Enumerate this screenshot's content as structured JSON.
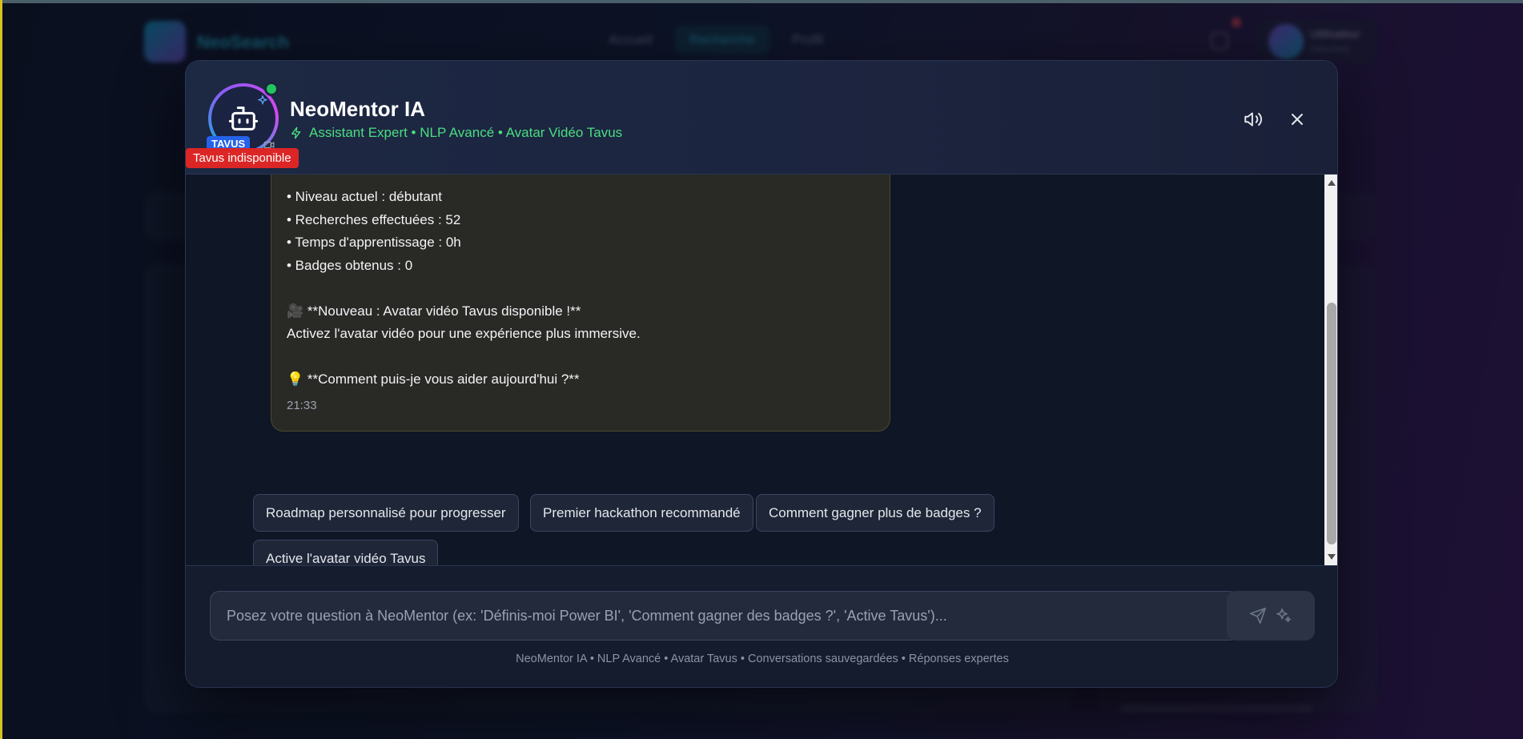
{
  "background": {
    "brand": "NeoSearch",
    "nav": [
      "Accueil",
      "Recherche",
      "Profil"
    ],
    "user_name": "Utilisateur",
    "user_role": "Débutant"
  },
  "modal": {
    "title": "NeoMentor IA",
    "subtitle": "Assistant Expert • NLP Avancé • Avatar Vidéo Tavus",
    "tavus_badge": "TAVUS",
    "tavus_status": "Tavus indisponible",
    "online": true
  },
  "message": {
    "lines": [
      "• Niveau actuel : débutant",
      "• Recherches effectuées : 52",
      "• Temps d'apprentissage : 0h",
      "• Badges obtenus : 0",
      "",
      "🎥 **Nouveau : Avatar vidéo Tavus disponible !**",
      "Activez l'avatar vidéo pour une expérience plus immersive.",
      "",
      "💡 **Comment puis-je vous aider aujourd'hui ?**"
    ],
    "time": "21:33"
  },
  "suggestions": [
    "Roadmap personnalisé pour progresser",
    "Premier hackathon recommandé",
    "Comment gagner plus de badges ?",
    "Active l'avatar vidéo Tavus"
  ],
  "input": {
    "placeholder": "Posez votre question à NeoMentor (ex: 'Définis-moi Power BI', 'Comment gagner des badges ?', 'Active Tavus')...",
    "value": ""
  },
  "footer": "NeoMentor IA • NLP Avancé • Avatar Tavus • Conversations sauvegardées • Réponses expertes",
  "colors": {
    "accent_green": "#4ade80",
    "tavus_blue": "#2563eb",
    "error_red": "#dc2626",
    "bubble_bg": "#292a26"
  }
}
